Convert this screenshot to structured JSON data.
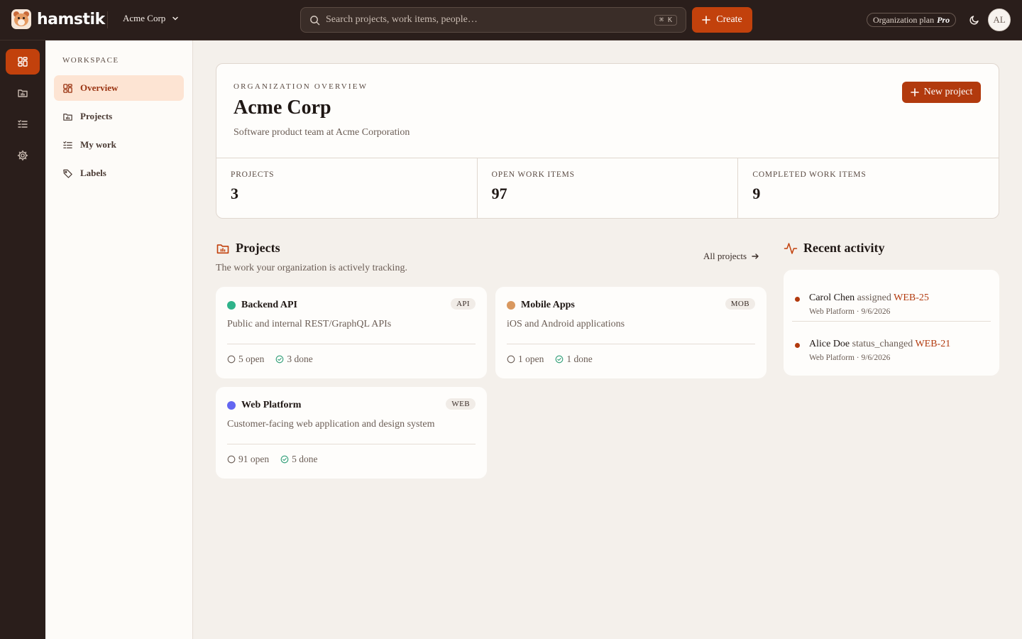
{
  "brand": {
    "name": "hamstik"
  },
  "header": {
    "org_name": "Acme Corp",
    "search_placeholder": "Search projects, work items, people…",
    "search_shortcut": "⌘ K",
    "create_label": "Create",
    "plan_label": "Organization plan",
    "plan_tier": "Pro",
    "avatar_initials": "AL"
  },
  "sidebar": {
    "heading": "WORKSPACE",
    "items": [
      {
        "label": "Overview",
        "icon": "grid-icon",
        "active": true
      },
      {
        "label": "Projects",
        "icon": "folder-icon",
        "active": false
      },
      {
        "label": "My work",
        "icon": "checklist-icon",
        "active": false
      },
      {
        "label": "Labels",
        "icon": "tag-icon",
        "active": false
      }
    ]
  },
  "overview": {
    "eyebrow": "ORGANIZATION OVERVIEW",
    "title": "Acme Corp",
    "description": "Software product team at Acme Corporation",
    "new_project_label": "New project",
    "stats": [
      {
        "label": "PROJECTS",
        "value": "3"
      },
      {
        "label": "OPEN WORK ITEMS",
        "value": "97"
      },
      {
        "label": "COMPLETED WORK ITEMS",
        "value": "9"
      }
    ]
  },
  "projects": {
    "title": "Projects",
    "subtitle": "The work your organization is actively tracking.",
    "all_label": "All projects",
    "items": [
      {
        "name": "Backend API",
        "key": "API",
        "color": "#2fb38a",
        "description": "Public and internal REST/GraphQL APIs",
        "open": "5 open",
        "done": "3 done"
      },
      {
        "name": "Mobile Apps",
        "key": "MOB",
        "color": "#d9985f",
        "description": "iOS and Android applications",
        "open": "1 open",
        "done": "1 done"
      },
      {
        "name": "Web Platform",
        "key": "WEB",
        "color": "#6366f1",
        "description": "Customer-facing web application and design system",
        "open": "91 open",
        "done": "5 done"
      }
    ]
  },
  "activity": {
    "title": "Recent activity",
    "items": [
      {
        "actor": "Carol Chen",
        "verb": "assigned",
        "ref": "WEB-25",
        "project": "Web Platform",
        "date": "9/6/2026"
      },
      {
        "actor": "Alice Doe",
        "verb": "status_changed",
        "ref": "WEB-21",
        "project": "Web Platform",
        "date": "9/6/2026"
      }
    ]
  },
  "colors": {
    "accent": "#c2410c",
    "topbar": "#2a1e1b",
    "background": "#f4f0eb"
  }
}
